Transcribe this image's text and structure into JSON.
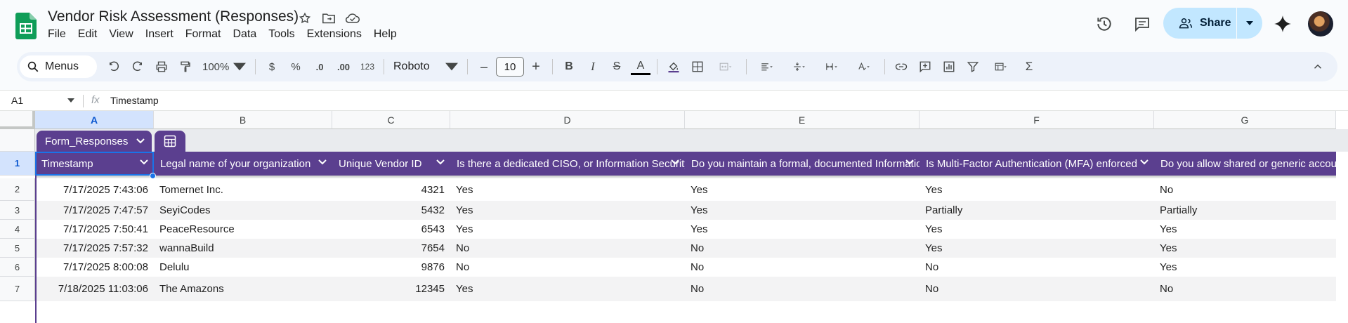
{
  "document": {
    "title": "Vendor Risk Assessment (Responses)"
  },
  "menu": [
    "File",
    "Edit",
    "View",
    "Insert",
    "Format",
    "Data",
    "Tools",
    "Extensions",
    "Help"
  ],
  "share": {
    "label": "Share"
  },
  "toolbar": {
    "search_label": "Menus",
    "zoom": "100%",
    "currency": "$",
    "percent": "%",
    "decrease_decimal": ".0",
    "increase_decimal": ".00",
    "number_format": "123",
    "font": "Roboto",
    "font_size": "10",
    "minus": "–",
    "plus": "+",
    "bold": "B",
    "italic": "I",
    "strike": "S",
    "text_color": "A"
  },
  "formula_bar": {
    "cell_ref": "A1",
    "fx": "fx",
    "value": "Timestamp"
  },
  "columns": [
    "A",
    "B",
    "C",
    "D",
    "E",
    "F",
    "G"
  ],
  "table": {
    "name": "Form_Responses",
    "headers": [
      "Timestamp",
      "Legal name of your organization",
      "Unique Vendor ID",
      "Is there a dedicated CISO, or Information Security",
      "Do you maintain a formal, documented Information",
      "Is Multi-Factor Authentication (MFA) enforced",
      "Do you allow shared or generic accounts"
    ],
    "row_numbers": [
      "1",
      "2",
      "3",
      "4",
      "5",
      "6",
      "7"
    ],
    "rows": [
      [
        "7/17/2025 7:43:06",
        "Tomernet Inc.",
        "4321",
        "Yes",
        "Yes",
        "Yes",
        "No"
      ],
      [
        "7/17/2025 7:47:57",
        "SeyiCodes",
        "5432",
        "Yes",
        "Yes",
        "Partially",
        "Partially"
      ],
      [
        "7/17/2025 7:50:41",
        "PeaceResource",
        "6543",
        "Yes",
        "Yes",
        "Yes",
        "Yes"
      ],
      [
        "7/17/2025 7:57:32",
        "wannaBuild",
        "7654",
        "No",
        "No",
        "Yes",
        "Yes"
      ],
      [
        "7/17/2025 8:00:08",
        "Delulu",
        "9876",
        "No",
        "No",
        "No",
        "Yes"
      ],
      [
        "7/18/2025 11:03:06",
        "The Amazons",
        "12345",
        "Yes",
        "No",
        "No",
        "No"
      ]
    ]
  },
  "colors": {
    "table_header": "#5b3f8f",
    "share_bg": "#c2e7ff",
    "selection": "#1a73e8"
  }
}
